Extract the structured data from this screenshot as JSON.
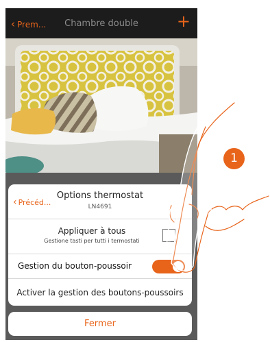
{
  "top_bar": {
    "back_label": "Prem...",
    "back_icon": "chevron-left-icon",
    "title": "Chambre double",
    "add_label": "+"
  },
  "sheet": {
    "prev_label": "Précéd...",
    "title": "Options thermostat",
    "subtitle": "LN4691",
    "apply_all": {
      "label": "Appliquer à tous",
      "sublabel": "Gestione tasti per tutti i termostati",
      "checked": false
    },
    "pushbutton": {
      "label": "Gestion du bouton-poussoir",
      "enabled": true
    },
    "activate_label": "Activer la gestion des boutons-poussoirs"
  },
  "close_label": "Fermer",
  "step_number": "1",
  "colors": {
    "accent": "#e8641b",
    "topbar": "#1c1c1c",
    "overlay": "#5a5a5a"
  }
}
